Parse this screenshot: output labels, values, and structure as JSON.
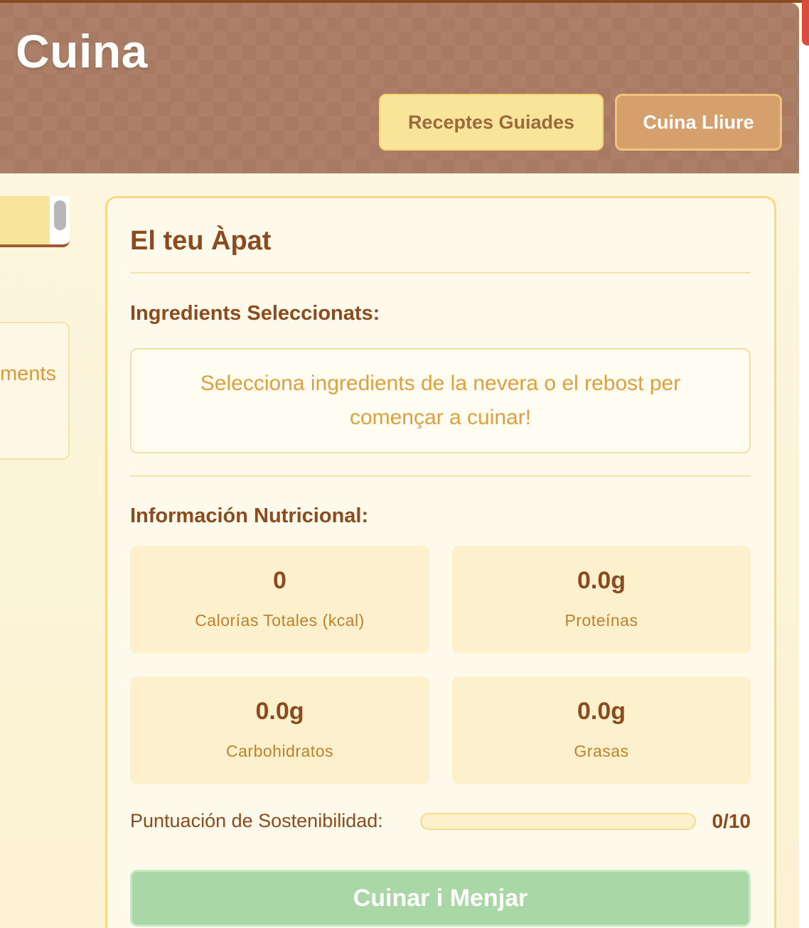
{
  "header": {
    "title": "Cuina",
    "modes": [
      {
        "label": "Receptes Guiades"
      },
      {
        "label": "Cuina Lliure"
      }
    ]
  },
  "sidebar": {
    "partial_text": "ments"
  },
  "meal": {
    "title": "El teu Àpat",
    "ingredients_label": "Ingredients Seleccionats:",
    "empty_message": "Selecciona ingredients de la nevera o el rebost per començar a cuinar!",
    "nutrition_label": "Información Nutricional:",
    "stats": [
      {
        "value": "0",
        "label": "Calorías Totales (kcal)"
      },
      {
        "value": "0.0g",
        "label": "Proteínas"
      },
      {
        "value": "0.0g",
        "label": "Carbohidratos"
      },
      {
        "value": "0.0g",
        "label": "Grasas"
      }
    ],
    "sustainability": {
      "label": "Puntuación de Sostenibilidad:",
      "score": 0,
      "max": 10,
      "display": "0/10"
    },
    "cook_button": "Cuinar i Menjar"
  }
}
